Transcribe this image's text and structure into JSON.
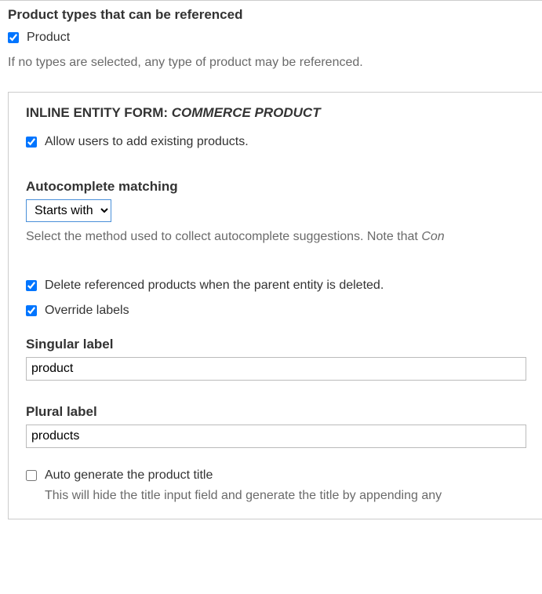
{
  "top": {
    "heading": "Product types that can be referenced",
    "product_checkbox_label": "Product",
    "help": "If no types are selected, any type of product may be referenced."
  },
  "fieldset": {
    "legend_prefix": "INLINE ENTITY FORM: ",
    "legend_italic": "COMMERCE PRODUCT",
    "allow_existing_label": "Allow users to add existing products.",
    "autocomplete": {
      "label": "Autocomplete matching",
      "selected": "Starts with",
      "description_prefix": "Select the method used to collect autocomplete suggestions. Note that ",
      "description_italic": "Con"
    },
    "delete_label": "Delete referenced products when the parent entity is deleted.",
    "override_label": "Override labels",
    "singular": {
      "label": "Singular label",
      "value": "product"
    },
    "plural": {
      "label": "Plural label",
      "value": "products"
    },
    "autogen": {
      "label": "Auto generate the product title",
      "help": "This will hide the title input field and generate the title by appending any"
    }
  }
}
